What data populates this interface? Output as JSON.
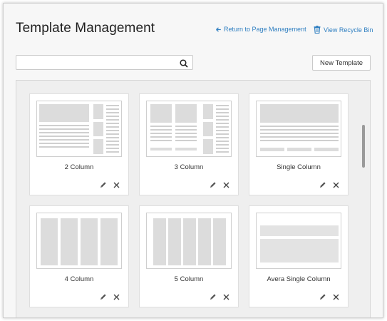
{
  "header": {
    "title": "Template Management",
    "return_link": "Return to Page Management",
    "recycle_link": "View Recycle Bin"
  },
  "toolbar": {
    "search_value": "",
    "new_template_label": "New Template"
  },
  "icons": {
    "search": "search-icon",
    "return": "arrow-left-icon",
    "recycle": "trash-icon",
    "edit": "pencil-icon",
    "delete": "close-icon"
  },
  "colors": {
    "link": "#2f7fc1",
    "placeholder_block": "#dcdcdc"
  },
  "templates": [
    {
      "label": "2 Column",
      "layout": "two-column"
    },
    {
      "label": "3 Column",
      "layout": "three-column"
    },
    {
      "label": "Single Column",
      "layout": "single-column"
    },
    {
      "label": "4 Column",
      "layout": "four-column"
    },
    {
      "label": "5 Column",
      "layout": "five-column"
    },
    {
      "label": "Avera Single Column",
      "layout": "avera-single-column"
    }
  ]
}
